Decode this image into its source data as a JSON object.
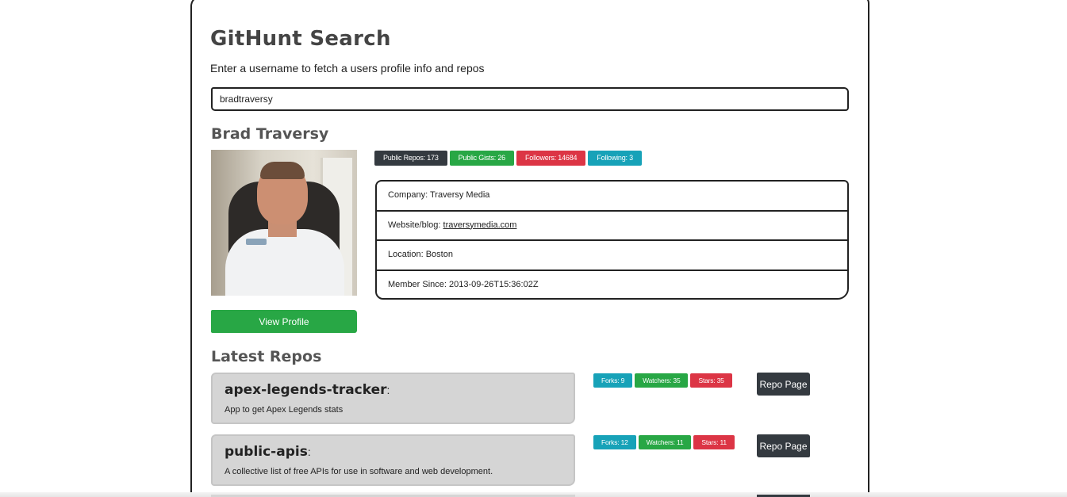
{
  "page": {
    "title": "GitHunt Search",
    "subtitle": "Enter a username to fetch a users profile info and repos"
  },
  "search": {
    "value": "bradtraversy"
  },
  "profile": {
    "name": "Brad Traversy",
    "view_profile_label": "View Profile",
    "badges": {
      "public_repos": "Public Repos: 173",
      "public_gists": "Public Gists: 26",
      "followers": "Followers: 14684",
      "following": "Following: 3"
    },
    "company": "Company: Traversy Media",
    "website_label": "Website/blog:",
    "website_link": "traversymedia.com",
    "location": "Location: Boston",
    "member_since": "Member Since: 2013-09-26T15:36:02Z"
  },
  "repos": {
    "heading": "Latest Repos",
    "items": [
      {
        "name": "apex-legends-tracker",
        "colon": ":",
        "description": "App to get Apex Legends stats",
        "forks": "Forks: 9",
        "watchers": "Watchers: 35",
        "stars": "Stars: 35",
        "button": "Repo Page"
      },
      {
        "name": "public-apis",
        "colon": ":",
        "description": "A collective list of free APIs for use in software and web development.",
        "forks": "Forks: 12",
        "watchers": "Watchers: 11",
        "stars": "Stars: 11",
        "button": "Repo Page"
      }
    ]
  },
  "colors": {
    "dark": "#343a40",
    "green": "#28a745",
    "red": "#dc3545",
    "teal": "#17a2b8",
    "repo_box": "#d5d5d5"
  }
}
